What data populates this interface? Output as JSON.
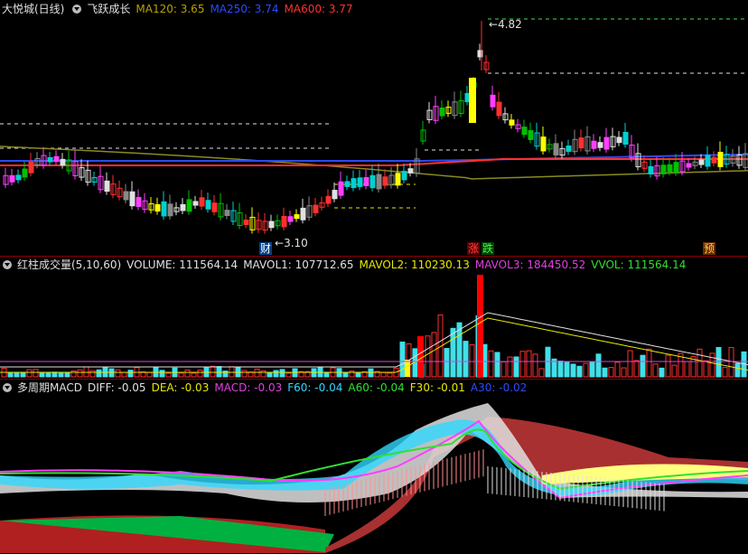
{
  "panels": {
    "main": {
      "stock_name": "大悦城(日线)",
      "indicator": "飞跃成长",
      "items": [
        {
          "label": "MA120:",
          "value": "3.65",
          "color": "#b8a000"
        },
        {
          "label": "MA250:",
          "value": "3.74",
          "color": "#2a4bff"
        },
        {
          "label": "MA600:",
          "value": "3.77",
          "color": "#ff3030"
        }
      ],
      "high_label": "4.82",
      "low_label": "3.10",
      "markers": [
        "财",
        "涨",
        "跌",
        "预"
      ]
    },
    "volume": {
      "title": "红柱成交量(5,10,60)",
      "items": [
        {
          "label": "VOLUME:",
          "value": "111564.14",
          "color": "#e0e0e0"
        },
        {
          "label": "MAVOL1:",
          "value": "107712.65",
          "color": "#e0e0e0"
        },
        {
          "label": "MAVOL2:",
          "value": "110230.13",
          "color": "#e8e800"
        },
        {
          "label": "MAVOL3:",
          "value": "184450.52",
          "color": "#e040e0"
        },
        {
          "label": "VVOL:",
          "value": "111564.14",
          "color": "#30e030"
        }
      ]
    },
    "macd": {
      "title": "多周期MACD",
      "items": [
        {
          "label": "DIFF:",
          "value": "-0.05",
          "color": "#e0e0e0"
        },
        {
          "label": "DEA:",
          "value": "-0.03",
          "color": "#e8e800"
        },
        {
          "label": "MACD:",
          "value": "-0.03",
          "color": "#e040e0"
        },
        {
          "label": "F60:",
          "value": "-0.04",
          "color": "#30d8ff"
        },
        {
          "label": "A60:",
          "value": "-0.04",
          "color": "#30e030"
        },
        {
          "label": "F30:",
          "value": "-0.01",
          "color": "#e8e800"
        },
        {
          "label": "A30:",
          "value": "-0.02",
          "color": "#2a4bff"
        }
      ]
    }
  },
  "colors": {
    "up": "#ff3030",
    "down": "#00c0c0",
    "bg": "#000000"
  }
}
